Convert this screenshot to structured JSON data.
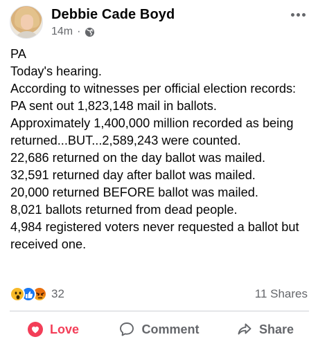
{
  "post": {
    "author": "Debbie Cade Boyd",
    "timestamp": "14m",
    "separator": "·",
    "privacy_icon": "globe-icon",
    "body_lines": [
      "PA",
      "Today's hearing.",
      "According to witnesses per official election records:",
      "PA sent out 1,823,148 mail in ballots.",
      "Approximately 1,400,000 million recorded as being returned...BUT...2,589,243 were counted.",
      "22,686 returned on the day ballot was mailed.",
      "32,591 returned day after ballot was mailed.",
      "20,000 returned BEFORE ballot was mailed.",
      "8,021 ballots returned from dead people.",
      "4,984 registered voters never requested a ballot but received one."
    ]
  },
  "engagement": {
    "reaction_icons": [
      "wow-reaction-icon",
      "like-reaction-icon",
      "angry-reaction-icon"
    ],
    "reaction_count": "32",
    "shares": "11 Shares"
  },
  "actions": {
    "love_label": "Love",
    "comment_label": "Comment",
    "share_label": "Share"
  },
  "colors": {
    "love_active": "#f33e58",
    "secondary_text": "#65676b",
    "like_blue": "#1877f2"
  }
}
